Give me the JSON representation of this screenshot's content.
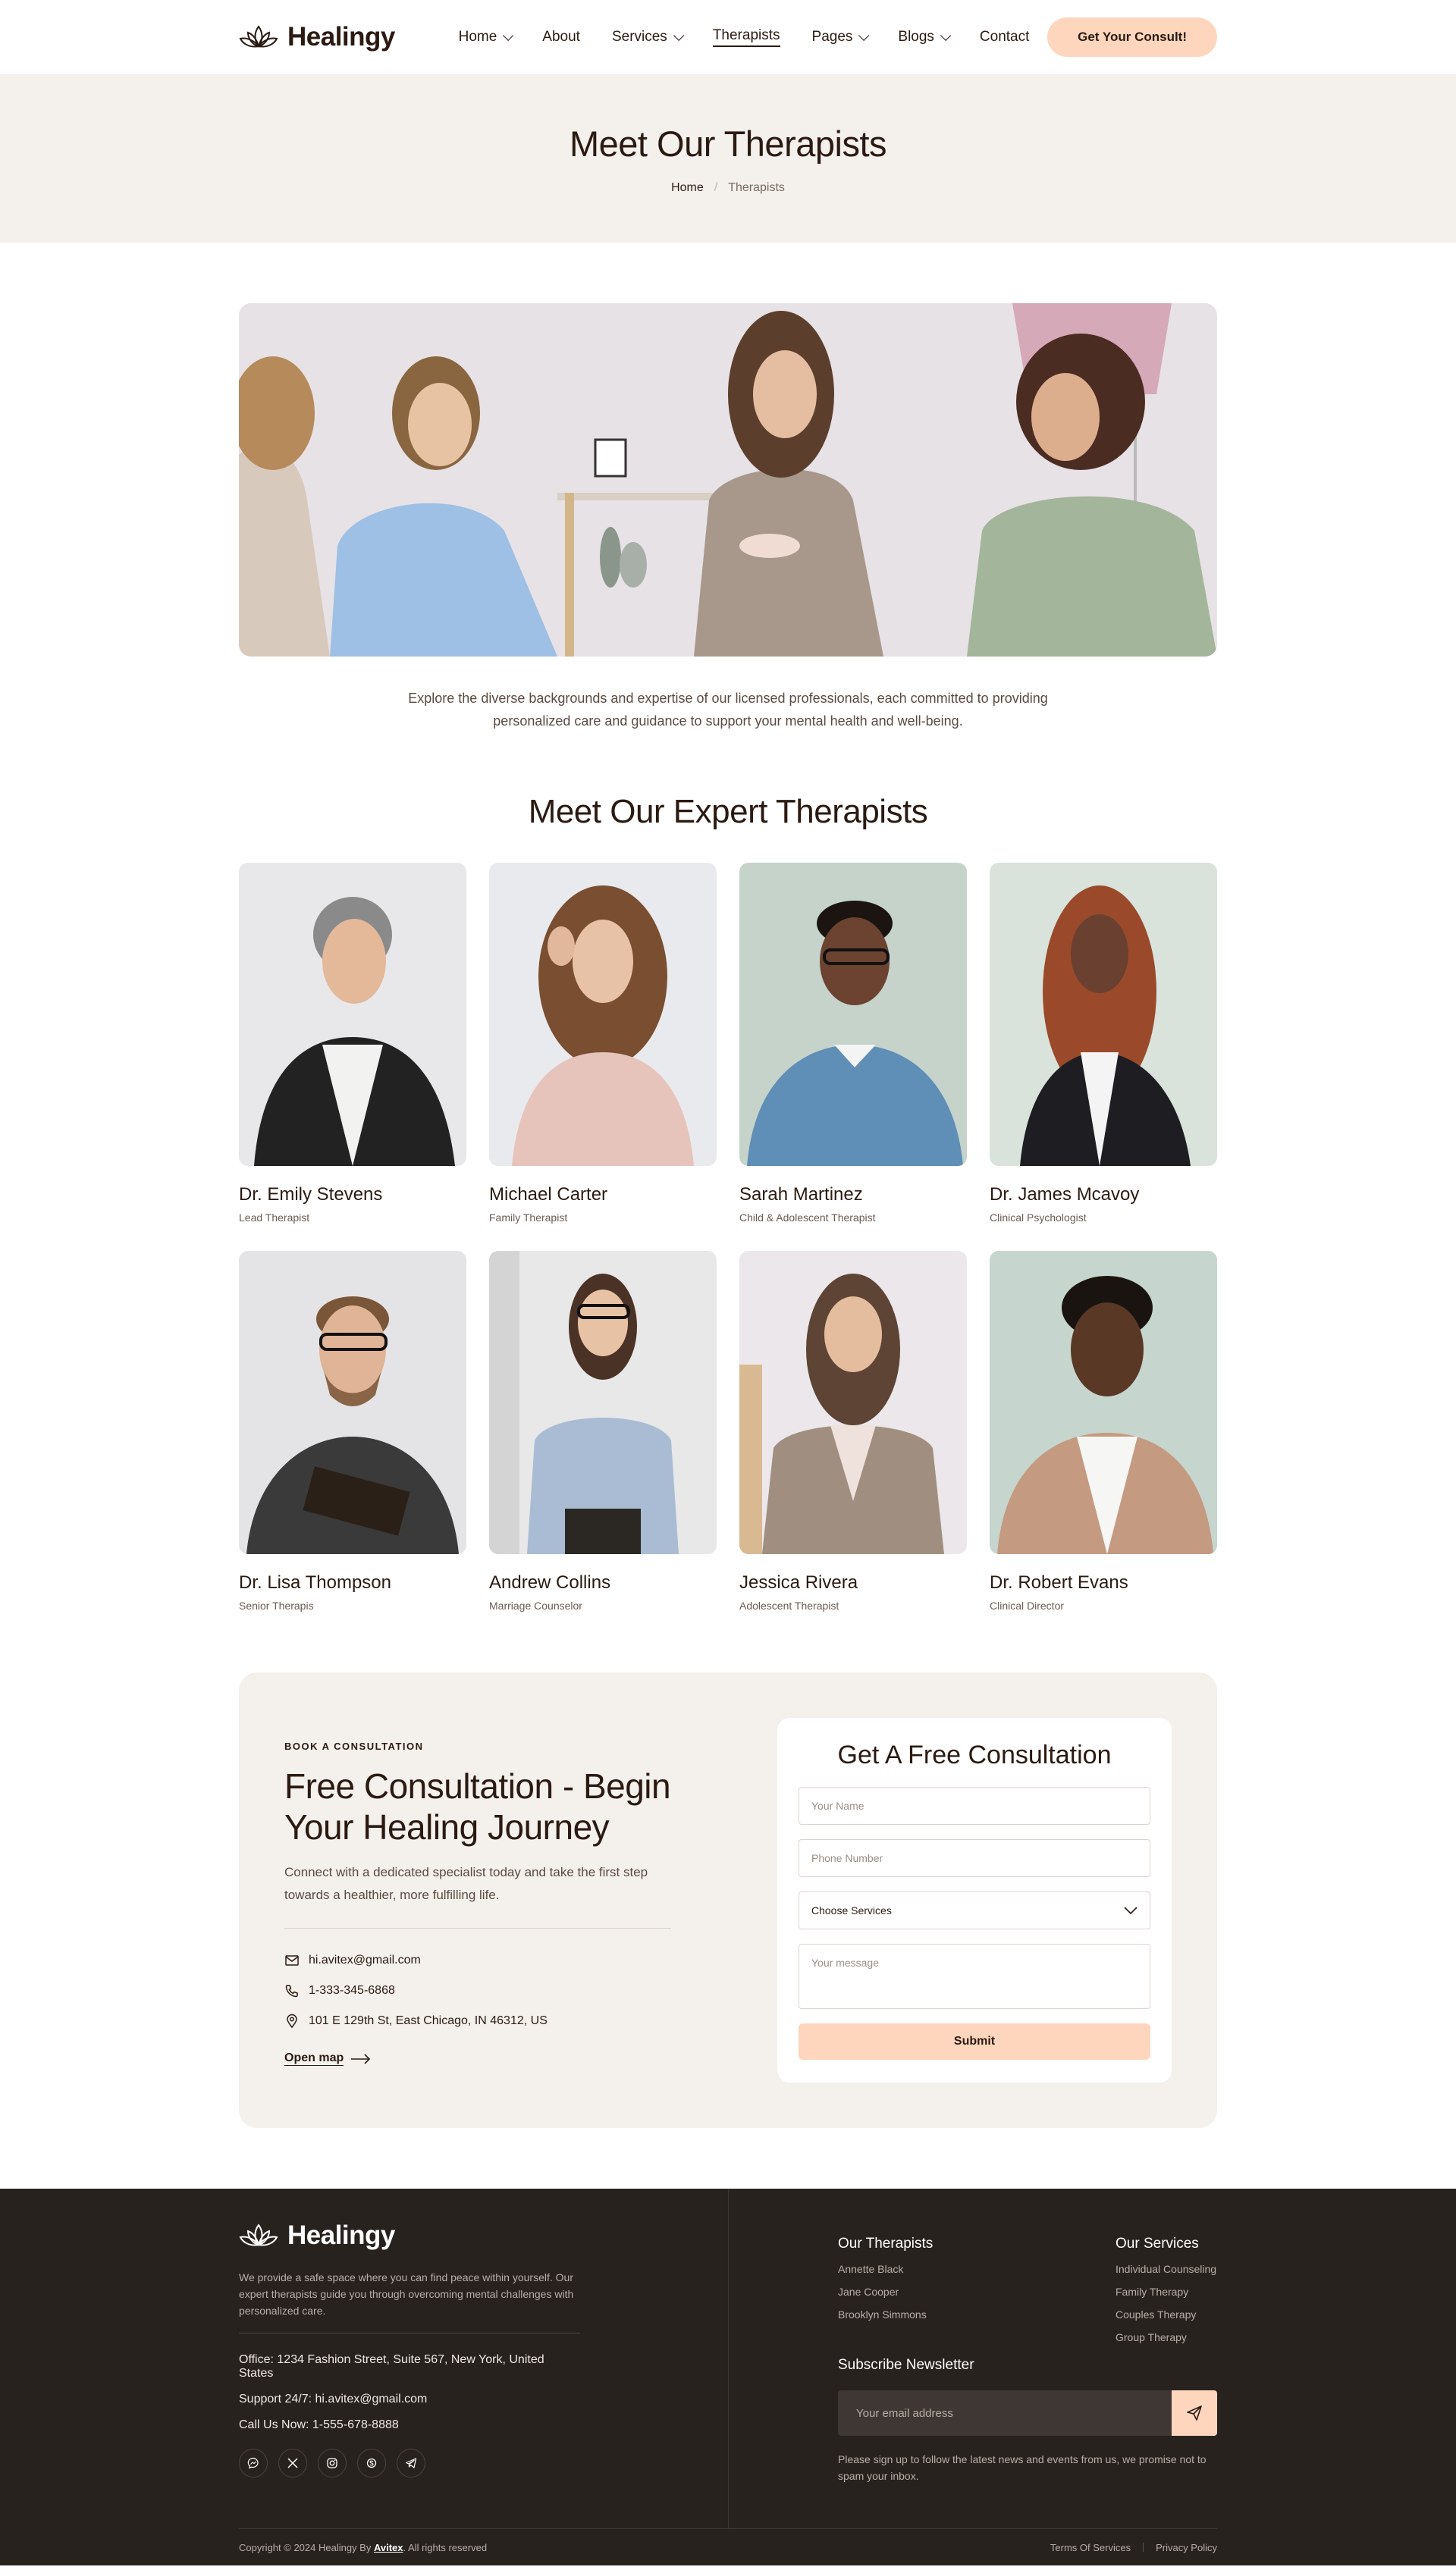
{
  "brand": {
    "name": "Healingy"
  },
  "nav": {
    "items": [
      {
        "label": "Home",
        "dropdown": true
      },
      {
        "label": "About",
        "dropdown": false
      },
      {
        "label": "Services",
        "dropdown": true
      },
      {
        "label": "Therapists",
        "dropdown": false,
        "active": true
      },
      {
        "label": "Pages",
        "dropdown": true
      },
      {
        "label": "Blogs",
        "dropdown": true
      },
      {
        "label": "Contact",
        "dropdown": false
      }
    ],
    "cta": "Get Your Consult!"
  },
  "page": {
    "title": "Meet Our Therapists",
    "breadcrumb": {
      "home": "Home",
      "separator": "/",
      "current": "Therapists"
    },
    "intro": "Explore the diverse backgrounds and expertise of our licensed professionals, each committed to providing personalized care and guidance to support your mental health and well-being."
  },
  "team": {
    "title": "Meet Our Expert Therapists",
    "members": [
      {
        "name": "Dr. Emily Stevens",
        "role": "Lead Therapist"
      },
      {
        "name": "Michael Carter",
        "role": "Family Therapist"
      },
      {
        "name": "Sarah Martinez",
        "role": "Child & Adolescent Therapist"
      },
      {
        "name": "Dr. James Mcavoy",
        "role": "Clinical Psychologist"
      },
      {
        "name": "Dr. Lisa Thompson",
        "role": "Senior Therapis"
      },
      {
        "name": "Andrew Collins",
        "role": "Marriage Counselor"
      },
      {
        "name": "Jessica Rivera",
        "role": "Adolescent Therapist"
      },
      {
        "name": "Dr. Robert Evans",
        "role": "Clinical Director"
      }
    ]
  },
  "consultation": {
    "eyebrow": "BOOK A CONSULTATION",
    "title": "Free Consultation - Begin Your Healing Journey",
    "text": "Connect with a dedicated specialist today and take the first step towards a healthier, more fulfilling life.",
    "email": "hi.avitex@gmail.com",
    "phone": "1-333-345-6868",
    "address": "101 E 129th St, East Chicago, IN 46312, US",
    "open_map": "Open map",
    "form": {
      "title": "Get A Free Consultation",
      "name_placeholder": "Your Name",
      "phone_placeholder": "Phone Number",
      "service_selected": "Choose Services",
      "message_placeholder": "Your message",
      "submit": "Submit"
    }
  },
  "footer": {
    "description": "We provide a safe space where you can find peace within yourself. Our expert therapists guide you through overcoming mental challenges with personalized care.",
    "office": "Office: 1234 Fashion Street, Suite 567, New York, United States",
    "support": "Support 24/7: hi.avitex@gmail.com",
    "call": "Call Us Now: 1-555-678-8888",
    "socials": [
      "messenger-icon",
      "x-icon",
      "instagram-icon",
      "skype-icon",
      "telegram-icon"
    ],
    "therapists": {
      "title": "Our Therapists",
      "links": [
        "Annette Black",
        "Jane Cooper",
        "Brooklyn Simmons"
      ]
    },
    "services": {
      "title": "Our Services",
      "links": [
        "Individual Counseling",
        "Family Therapy",
        "Couples Therapy",
        "Group Therapy"
      ]
    },
    "newsletter": {
      "title": "Subscribe Newsletter",
      "placeholder": "Your email address",
      "note": "Please sign up to follow the latest news and events from us, we promise not to spam your inbox."
    },
    "copyright_prefix": "Copyright © 2024 Healingy By",
    "copyright_brand": "Avitex",
    "copyright_suffix": ". All rights reserved",
    "terms": "Terms Of Services",
    "privacy": "Privacy Policy"
  },
  "colors": {
    "accent": "#fdd6bd",
    "dark": "#2b1a12",
    "band": "#f4f0eb",
    "footer": "#28221f"
  }
}
